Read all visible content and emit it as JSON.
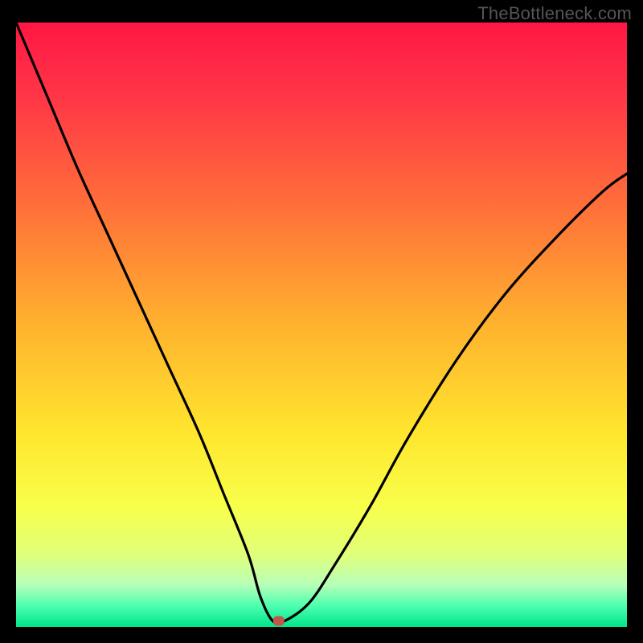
{
  "watermark": "TheBottleneck.com",
  "chart_data": {
    "type": "line",
    "title": "",
    "xlabel": "",
    "ylabel": "",
    "xlim": [
      0,
      100
    ],
    "ylim": [
      0,
      100
    ],
    "grid": false,
    "legend": false,
    "series": [
      {
        "name": "bottleneck-curve",
        "x": [
          0,
          5,
          10,
          15,
          20,
          25,
          30,
          34,
          38,
          40,
          42,
          44,
          48,
          52,
          58,
          64,
          72,
          80,
          88,
          96,
          100
        ],
        "values": [
          100,
          88,
          76,
          65,
          54,
          43,
          32,
          22,
          12,
          5,
          1,
          1,
          4,
          10,
          20,
          31,
          44,
          55,
          64,
          72,
          75
        ]
      }
    ],
    "marker": {
      "x": 43,
      "y": 1,
      "color": "#c0574a"
    },
    "background_gradient": {
      "stops": [
        {
          "offset": 0.0,
          "color": "#ff1744"
        },
        {
          "offset": 0.12,
          "color": "#ff3547"
        },
        {
          "offset": 0.3,
          "color": "#ff6e3a"
        },
        {
          "offset": 0.5,
          "color": "#ffb22e"
        },
        {
          "offset": 0.68,
          "color": "#ffe62e"
        },
        {
          "offset": 0.8,
          "color": "#f8ff4a"
        },
        {
          "offset": 0.88,
          "color": "#e0ff7a"
        },
        {
          "offset": 0.93,
          "color": "#b8ffb8"
        },
        {
          "offset": 0.965,
          "color": "#4dffb0"
        },
        {
          "offset": 1.0,
          "color": "#00e58a"
        }
      ]
    }
  }
}
